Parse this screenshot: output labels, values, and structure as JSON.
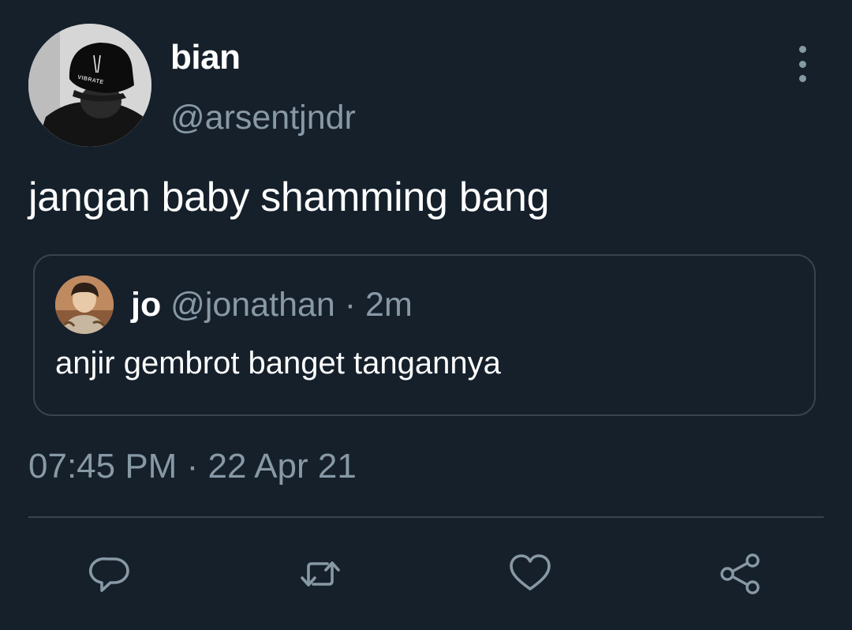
{
  "tweet": {
    "author": {
      "display_name": "bian",
      "handle": "@arsentjndr",
      "avatar_cap_text": "VIBRATE"
    },
    "text": "jangan baby shamming bang",
    "quoted": {
      "display_name": "jo",
      "handle": "@jonathan",
      "separator": "·",
      "time": "2m",
      "text": "anjir gembrot banget tangannya"
    },
    "timestamp": {
      "time": "07:45 PM",
      "separator": "·",
      "date": "22 Apr 21"
    }
  },
  "actions": [
    {
      "name": "reply",
      "icon": "reply-icon"
    },
    {
      "name": "retweet",
      "icon": "retweet-icon"
    },
    {
      "name": "like",
      "icon": "heart-icon"
    },
    {
      "name": "share",
      "icon": "share-icon"
    }
  ],
  "colors": {
    "background": "#15202b",
    "primary_text": "#ffffff",
    "secondary_text": "#8899a6",
    "border": "#38444d"
  }
}
